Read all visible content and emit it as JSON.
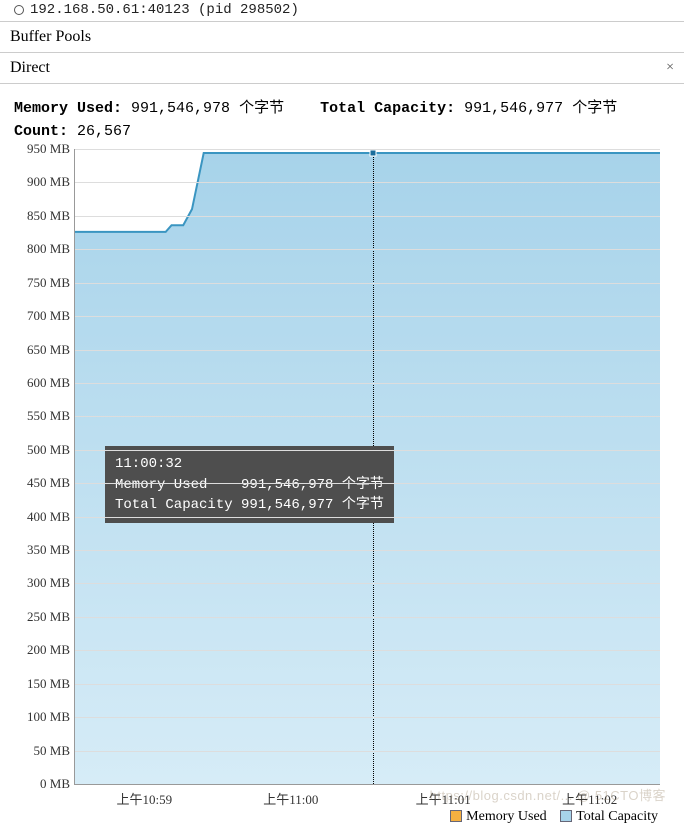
{
  "window": {
    "title": "192.168.50.61:40123 (pid 298502)"
  },
  "panels": {
    "buffer_pools": "Buffer Pools",
    "direct": "Direct"
  },
  "stats": {
    "memory_used_label": "Memory Used:",
    "memory_used_value": "991,546,978",
    "memory_used_unit": "个字节",
    "total_capacity_label": "Total Capacity:",
    "total_capacity_value": "991,546,977",
    "total_capacity_unit": "个字节",
    "count_label": "Count:",
    "count_value": "26,567"
  },
  "legend": {
    "memory_used": "Memory Used",
    "total_capacity": "Total Capacity"
  },
  "tooltip": {
    "time": "11:00:32",
    "row1_label": "Memory Used",
    "row1_value": "991,546,978 个字节",
    "row2_label": "Total Capacity",
    "row2_value": "991,546,977 个字节"
  },
  "chart_data": {
    "type": "area",
    "ylabel": "MB",
    "ylim": [
      0,
      950
    ],
    "y_ticks": [
      0,
      50,
      100,
      150,
      200,
      250,
      300,
      350,
      400,
      450,
      500,
      550,
      600,
      650,
      700,
      750,
      800,
      850,
      900,
      950
    ],
    "x_ticks": [
      "上午10:59",
      "上午11:00",
      "上午11:01",
      "上午11:02"
    ],
    "cursor_time": "上午11:00:32",
    "series": [
      {
        "name": "Memory Used",
        "color": "#f5b041"
      },
      {
        "name": "Total Capacity",
        "color": "#a7d3ea"
      }
    ],
    "points": [
      {
        "x_pct": 0.0,
        "mb": 826
      },
      {
        "x_pct": 15.5,
        "mb": 826
      },
      {
        "x_pct": 16.5,
        "mb": 836
      },
      {
        "x_pct": 18.5,
        "mb": 836
      },
      {
        "x_pct": 20.0,
        "mb": 860
      },
      {
        "x_pct": 22.0,
        "mb": 944
      },
      {
        "x_pct": 100.0,
        "mb": 944
      }
    ]
  },
  "watermark": "https://blog.csdn.net/... @ 51CTO博客"
}
